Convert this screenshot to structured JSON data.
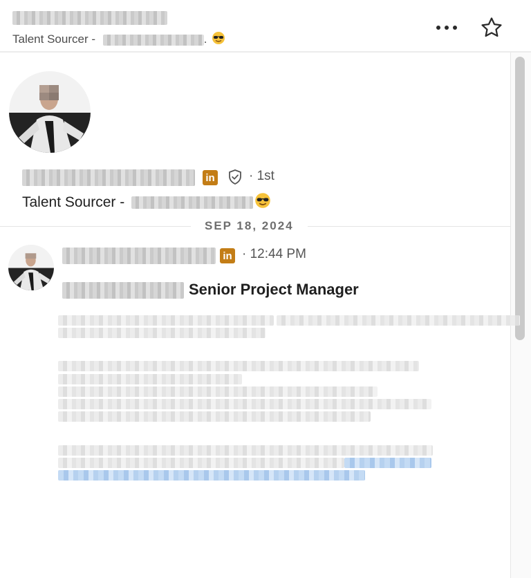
{
  "header": {
    "subtitle": "Talent Sourcer -",
    "more_icon": "more-horizontal-icon",
    "star_icon": "star-outline-icon"
  },
  "profile": {
    "degree": "· 1st",
    "subtitle": "Talent Sourcer -",
    "badge_icon": "linkedin-icon",
    "verified_icon": "verified-shield-icon"
  },
  "conversation": {
    "date": "SEP 18, 2024"
  },
  "message": {
    "time": "· 12:44 PM",
    "role": "Senior Project Manager"
  },
  "colors": {
    "linkedin_badge": "#c37d16",
    "link_blue": "#a9c8ec",
    "divider": "#e4e4e4"
  }
}
